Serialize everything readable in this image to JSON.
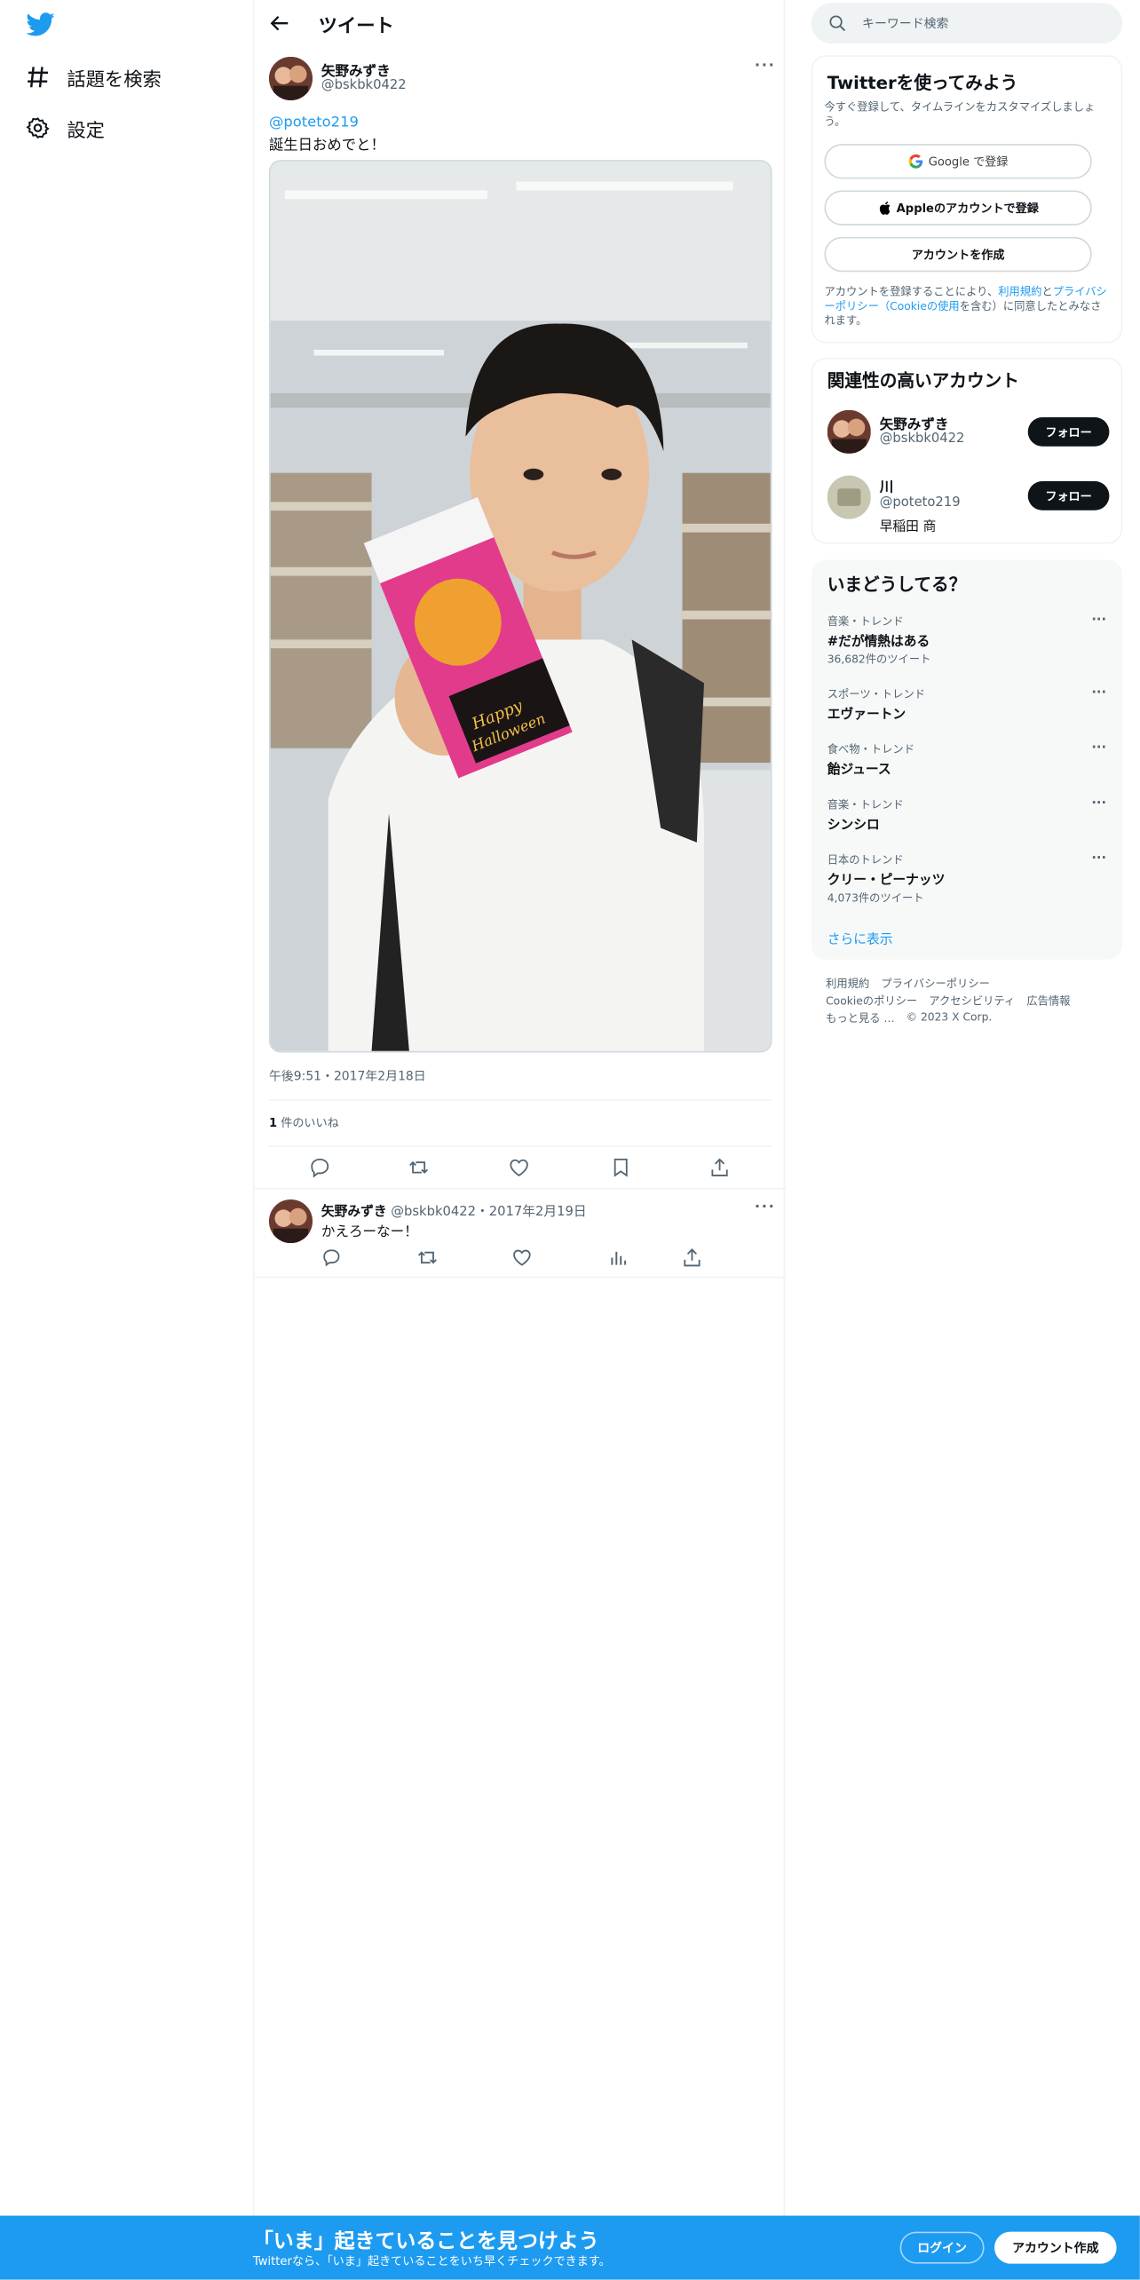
{
  "colors": {
    "accent": "#1d9bf0",
    "text": "#0f1419",
    "muted": "#536471",
    "border": "#eff3f4"
  },
  "nav": {
    "items": [
      {
        "label": "話題を検索",
        "icon": "hashtag-icon"
      },
      {
        "label": "設定",
        "icon": "gear-icon"
      }
    ]
  },
  "header": {
    "title": "ツイート"
  },
  "tweet": {
    "author_name": "矢野みずき",
    "author_handle": "@bskbk0422",
    "mention": "@poteto219",
    "text": "誕生日おめでと！",
    "timestamp": "午後9:51・2017年2月18日",
    "likes_count": "1",
    "likes_label": " 件のいいね"
  },
  "reply": {
    "author_name": "矢野みずき",
    "meta": " @bskbk0422・2017年2月19日",
    "text": "かえろーなー！"
  },
  "search": {
    "placeholder": "キーワード検索"
  },
  "signup": {
    "title": "Twitterを使ってみよう",
    "desc": "今すぐ登録して、タイムラインをカスタマイズしましょう。",
    "google": "Google で登録",
    "apple": "Appleのアカウントで登録",
    "create": "アカウントを作成",
    "legal_prefix": "アカウントを登録することにより、",
    "legal_terms": "利用規約",
    "legal_and": "と",
    "legal_privacy": "プライバシーポリシー（Cookieの使用",
    "legal_suffix": "を含む）に同意したとみなされます。"
  },
  "related": {
    "title": "関連性の高いアカウント",
    "accounts": [
      {
        "name": "矢野みずき",
        "handle": "@bskbk0422",
        "bio": "",
        "button": "フォロー"
      },
      {
        "name": "川",
        "handle": "@poteto219",
        "bio": "早稲田 商",
        "button": "フォロー"
      }
    ]
  },
  "trends": {
    "title": "いまどうしてる？",
    "items": [
      {
        "category": "音楽・トレンド",
        "name": "#だが情熱はある",
        "count": "36,682件のツイート"
      },
      {
        "category": "スポーツ・トレンド",
        "name": "エヴァートン",
        "count": ""
      },
      {
        "category": "食べ物・トレンド",
        "name": "飴ジュース",
        "count": ""
      },
      {
        "category": "音楽・トレンド",
        "name": "シンシロ",
        "count": ""
      },
      {
        "category": "日本のトレンド",
        "name": "クリー・ピーナッツ",
        "count": "4,073件のツイート"
      }
    ],
    "show_more": "さらに表示"
  },
  "footer": {
    "links1": [
      "利用規約",
      "プライバシーポリシー"
    ],
    "links2": [
      "Cookieのポリシー",
      "アクセシビリティ",
      "広告情報"
    ],
    "more": "もっと見る …",
    "copyright": "© 2023 X Corp."
  },
  "bottom_bar": {
    "title": "「いま」起きていることを見つけよう",
    "subtitle": "Twitterなら、「いま」起きていることをいち早くチェックできます。",
    "login": "ログイン",
    "signup": "アカウント作成"
  }
}
